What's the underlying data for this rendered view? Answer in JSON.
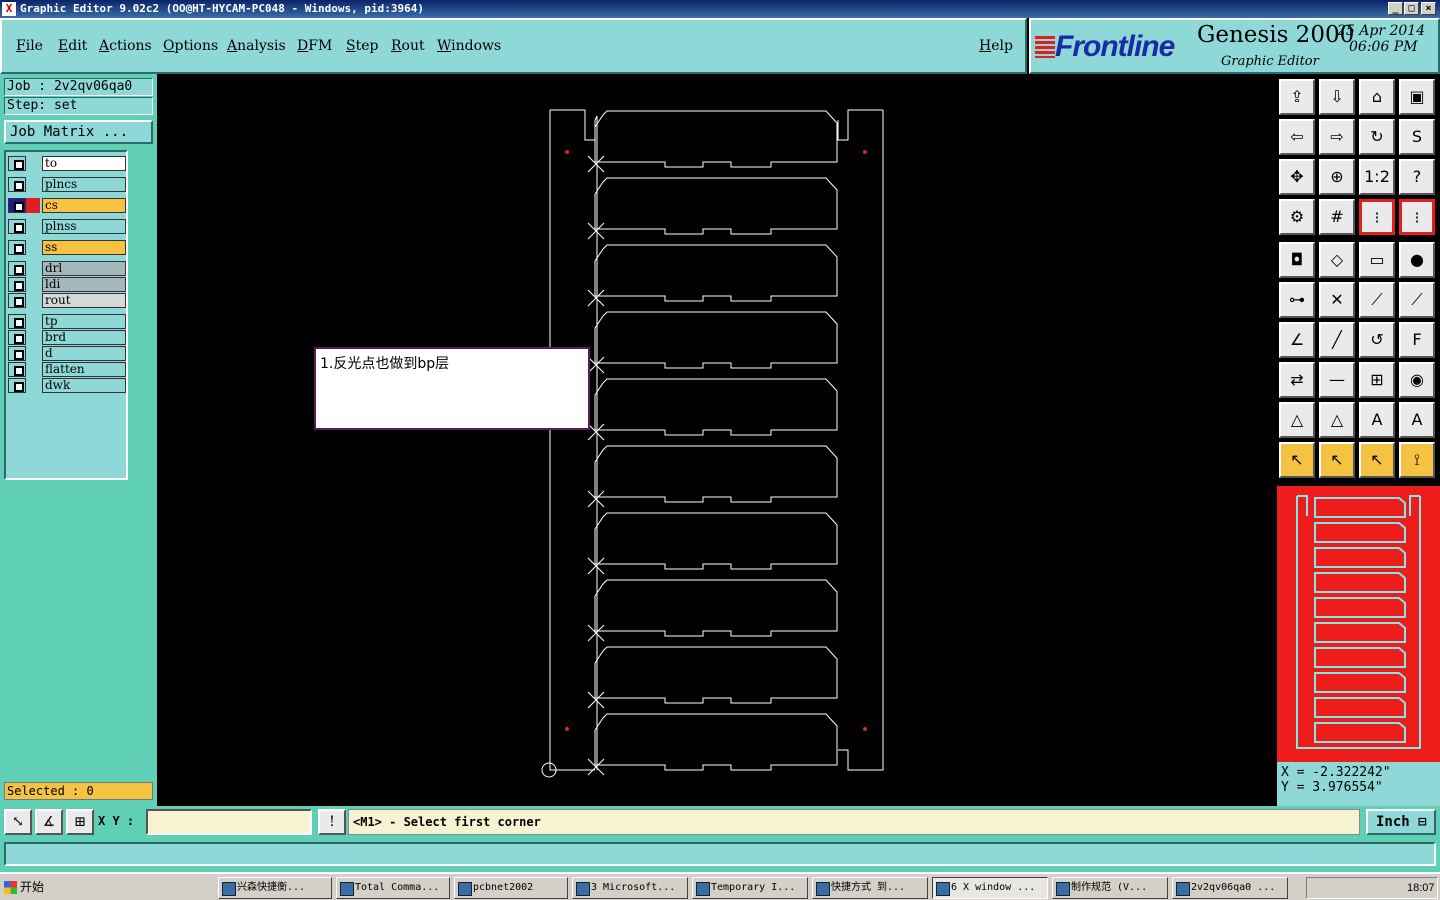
{
  "window": {
    "title": "Graphic Editor 9.02c2  (OO@HT-HYCAM-PC048 - Windows, pid:3964)"
  },
  "menu": [
    "File",
    "Edit",
    "Actions",
    "Options",
    "Analysis",
    "DFM",
    "Step",
    "Rout",
    "Windows"
  ],
  "help_label": "Help",
  "brand": {
    "logo": "Frontline",
    "product": "Genesis 2000",
    "subtitle": "Graphic Editor",
    "date": "25 Apr 2014",
    "time": "06:06 PM"
  },
  "job": {
    "job_line": "Job : 2v2qv06qa0",
    "step_line": "Step: set",
    "matrix_button": "Job Matrix ..."
  },
  "layers": [
    {
      "name": "to",
      "color": "#ffffff"
    },
    {
      "name": "plncs",
      "color": "#8fd8d8"
    },
    {
      "name": "cs",
      "color": "#f5c242",
      "active": true
    },
    {
      "name": "plnss",
      "color": "#8fd8d8"
    },
    {
      "name": "ss",
      "color": "#f5c242"
    },
    {
      "name": "drl",
      "color": "#a6b8bc"
    },
    {
      "name": "ldi",
      "color": "#a6b8bc"
    },
    {
      "name": "rout",
      "color": "#d8d8d8"
    },
    {
      "name": "tp",
      "color": "#8fd8d8"
    },
    {
      "name": "brd",
      "color": "#8fd8d8"
    },
    {
      "name": "d",
      "color": "#8fd8d8"
    },
    {
      "name": "flatten",
      "color": "#8fd8d8"
    },
    {
      "name": "dwk",
      "color": "#8fd8d8"
    }
  ],
  "selected_label": "Selected : 0",
  "note_text": "1.反光点也做到bp层",
  "coords": {
    "x": "X = -2.322242\"",
    "y": "Y = 3.976554\""
  },
  "tools": [
    {
      "icon": "export-icon",
      "glyph": "⇪"
    },
    {
      "icon": "import-icon",
      "glyph": "⇩"
    },
    {
      "icon": "home-icon",
      "glyph": "⌂"
    },
    {
      "icon": "window-icon",
      "glyph": "▣"
    },
    {
      "icon": "pan-left-icon",
      "glyph": "⇦"
    },
    {
      "icon": "pan-right-icon",
      "glyph": "⇨"
    },
    {
      "icon": "rotate-icon",
      "glyph": "↻"
    },
    {
      "icon": "mirror-icon",
      "glyph": "S"
    },
    {
      "icon": "zoom-fit-icon",
      "glyph": "✥"
    },
    {
      "icon": "zoom-center-icon",
      "glyph": "⊕"
    },
    {
      "icon": "scale-1-2-icon",
      "glyph": "1:2"
    },
    {
      "icon": "help-icon",
      "glyph": "?"
    },
    {
      "icon": "settings-icon",
      "glyph": "⚙"
    },
    {
      "icon": "grid-icon",
      "glyph": "#"
    },
    {
      "icon": "snap-icon",
      "glyph": "⁝",
      "style": "red"
    },
    {
      "icon": "snap-alt-icon",
      "glyph": "⁝",
      "style": "red"
    },
    {
      "icon": "pad-icon",
      "glyph": "◘"
    },
    {
      "icon": "polygon-icon",
      "glyph": "◇"
    },
    {
      "icon": "ruler-icon",
      "glyph": "▭"
    },
    {
      "icon": "circle-icon",
      "glyph": "●"
    },
    {
      "icon": "connect-icon",
      "glyph": "⊶"
    },
    {
      "icon": "cross-icon",
      "glyph": "✕"
    },
    {
      "icon": "line-icon",
      "glyph": "⟋"
    },
    {
      "icon": "line-alt-icon",
      "glyph": "⟋"
    },
    {
      "icon": "angle-icon",
      "glyph": "∠"
    },
    {
      "icon": "slash-icon",
      "glyph": "╱"
    },
    {
      "icon": "arc-icon",
      "glyph": "↺"
    },
    {
      "icon": "text-icon",
      "glyph": "F"
    },
    {
      "icon": "move-icon",
      "glyph": "⇄"
    },
    {
      "icon": "dash-icon",
      "glyph": "—"
    },
    {
      "icon": "measure-icon",
      "glyph": "⊞"
    },
    {
      "icon": "shapes-icon",
      "glyph": "◉"
    },
    {
      "icon": "triangle-icon",
      "glyph": "△"
    },
    {
      "icon": "triangle-alt-icon",
      "glyph": "△"
    },
    {
      "icon": "triangle-a-icon",
      "glyph": "A"
    },
    {
      "icon": "triangle-b-icon",
      "glyph": "A"
    },
    {
      "icon": "pointer-icon",
      "glyph": "↖",
      "style": "yel"
    },
    {
      "icon": "pointer-box-icon",
      "glyph": "↖",
      "style": "yel"
    },
    {
      "icon": "pointer-circle-icon",
      "glyph": "↖",
      "style": "yel"
    },
    {
      "icon": "pointer-node-icon",
      "glyph": "⟟",
      "style": "yel"
    }
  ],
  "bottom": {
    "xy_label": "X Y :",
    "xy_value": "",
    "alert_glyph": "!",
    "message": "<M1> - Select first corner",
    "unit": "Inch"
  },
  "taskbar": {
    "start": "开始",
    "items": [
      "兴森快捷衡...",
      "Total Comma...",
      "pcbnet2002",
      "3 Microsoft...",
      "Temporary I...",
      "快捷方式 到...",
      "6 X window ...",
      "制作规范 (V...",
      "2v2qv06qa0 ..."
    ],
    "clock": "18:07"
  },
  "colors": {
    "canvas": "#000000",
    "panel": "#5fcfb5",
    "menu": "#8fd8d8",
    "minimap": "#ef1c1c",
    "accent": "#f5c242"
  }
}
